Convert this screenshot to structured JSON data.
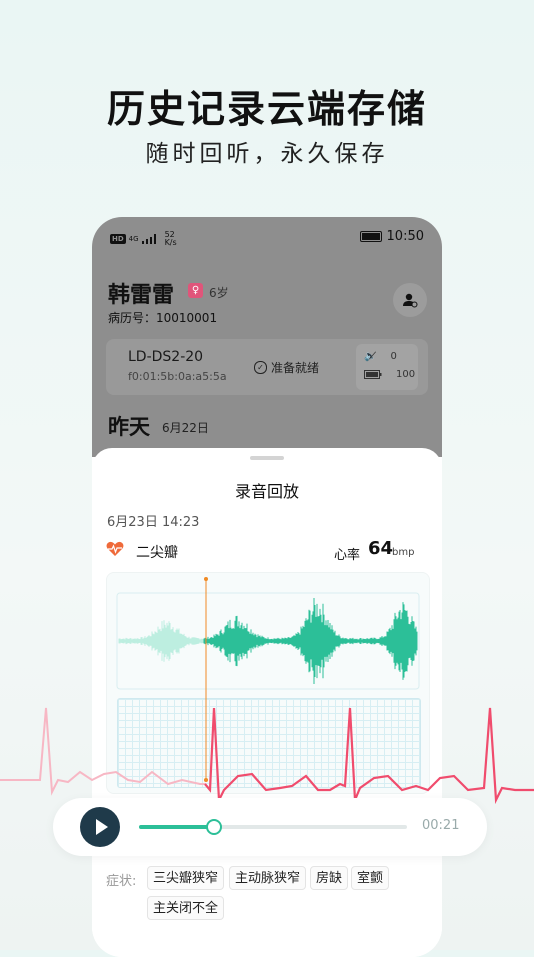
{
  "hero": {
    "title": "历史记录云端存储",
    "subtitle": "随时回听，永久保存"
  },
  "status_bar": {
    "net_badge": "HD",
    "net_type": "4G",
    "speed_value": "52",
    "speed_unit": "K/s",
    "time": "10:50"
  },
  "patient": {
    "name": "韩雷雷",
    "gender_symbol": "♀",
    "age": "6岁",
    "record_no": "病历号：10010001"
  },
  "device": {
    "name": "LD-DS2-20",
    "mac": "f0:01:5b:0a:a5:5a",
    "status": "准备就绪",
    "volume": "0",
    "battery": "100"
  },
  "history": {
    "section_title": "昨天",
    "section_date": "6月22日"
  },
  "sheet": {
    "title": "录音回放",
    "recorded_at": "6月23日 14:23",
    "diagnosis": "二尖瓣",
    "heart_rate_label": "心率",
    "heart_rate_value": "64",
    "heart_rate_unit": "bmp"
  },
  "player": {
    "elapsed": "00:21",
    "progress": 0.28
  },
  "symptoms": {
    "label": "症状:",
    "tags": [
      "三尖瓣狭窄",
      "主动脉狭窄",
      "房缺",
      "室颤",
      "主关闭不全"
    ]
  },
  "colors": {
    "accent": "#2cbf98",
    "wave_played": "#bdeee0",
    "ecg": "#f04c6d",
    "play_button": "#1f3a4a"
  }
}
